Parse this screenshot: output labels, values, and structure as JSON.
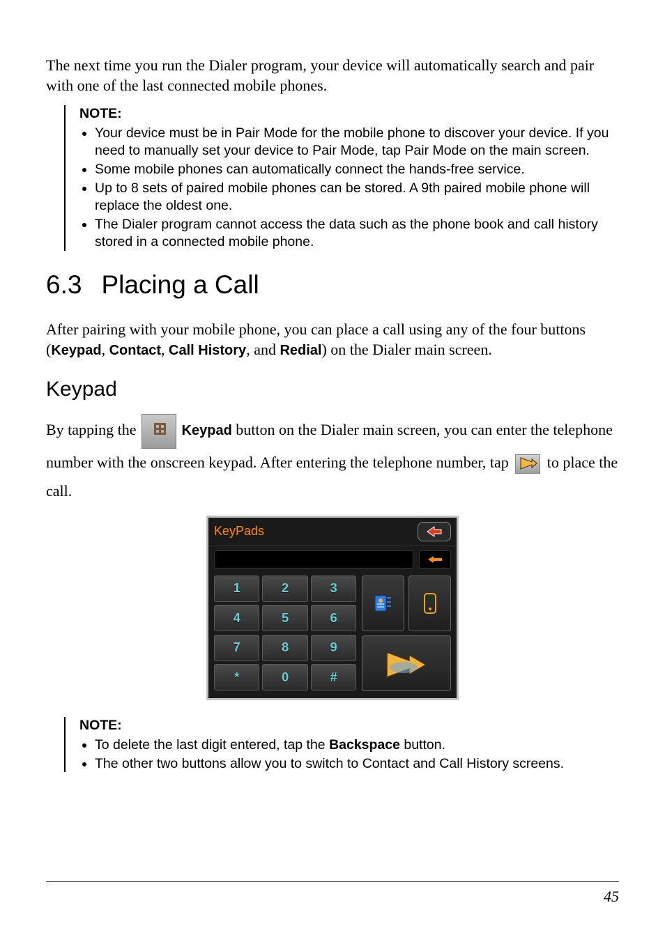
{
  "intro": "The next time you run the Dialer program, your device will automatically search and pair with one of the last connected mobile phones.",
  "note1": {
    "heading": "NOTE:",
    "items": [
      "Your device must be in Pair Mode for the mobile phone to discover your device. If you need to manually set your device to Pair Mode, tap Pair Mode on the main screen.",
      "Some mobile phones can automatically connect the hands-free service.",
      "Up to 8 sets of paired mobile phones can be stored. A 9th paired mobile phone will replace the oldest one.",
      "The Dialer program cannot access the data such as the phone book and call history stored in a connected mobile phone."
    ]
  },
  "section": {
    "number": "6.3",
    "title": "Placing a Call",
    "para_pre": "After pairing with your mobile phone, you can place a call using any of the four buttons (",
    "btns": {
      "k": "Keypad",
      "c": "Contact",
      "h": "Call History",
      "r": "Redial"
    },
    "para_post": ") on the Dialer main screen."
  },
  "subsection": {
    "title": "Keypad",
    "s1": "By tapping the",
    "keypad_label": "Keypad",
    "s2": " button on the Dialer main screen, you can enter the telephone number with the onscreen keypad. After entering the telephone number, tap",
    "s3": " to place the call."
  },
  "screenshot": {
    "title": "KeyPads",
    "keys": [
      "1",
      "2",
      "3",
      "4",
      "5",
      "6",
      "7",
      "8",
      "9",
      "*",
      "0",
      "#"
    ]
  },
  "note2": {
    "heading": "NOTE:",
    "items_pre": [
      "To delete the last digit entered, tap the ",
      "The other two buttons allow you to switch to Contact and Call History screens."
    ],
    "backspace_label": "Backspace",
    "item0_post": " button."
  },
  "page_number": "45"
}
